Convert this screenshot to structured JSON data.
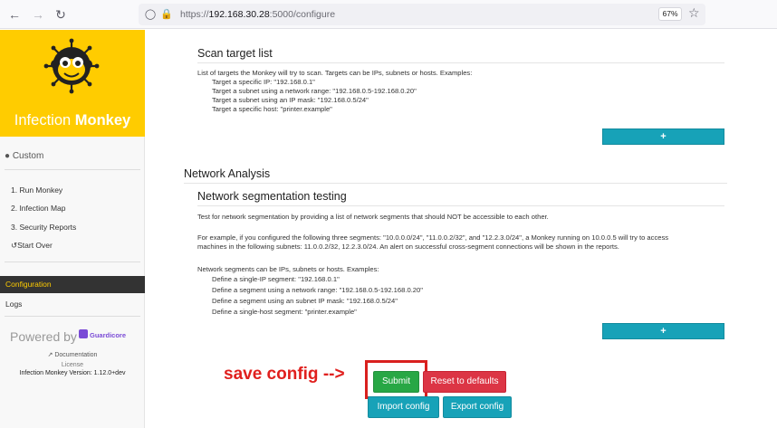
{
  "browser": {
    "url_scheme": "https://",
    "url_host": "192.168.30.28",
    "url_rest": ":5000/configure",
    "zoom": "67%"
  },
  "sidebar": {
    "brand_light": "Infection ",
    "brand_bold": "Monkey",
    "mode": "Custom",
    "steps": [
      "1. Run Monkey",
      "2. Infection Map",
      "3. Security Reports"
    ],
    "start_over": "Start Over",
    "configuration": "Configuration",
    "logs": "Logs",
    "powered_by": "Powered by",
    "guardicore": "Guardicore",
    "documentation": "Documentation",
    "license": "License",
    "version": "Infection Monkey Version: 1.12.0+dev"
  },
  "scan_target": {
    "title": "Scan target list",
    "intro": "List of targets the Monkey will try to scan. Targets can be IPs, subnets or hosts. Examples:",
    "examples": [
      "Target a specific IP: \"192.168.0.1\"",
      "Target a subnet using a network range: \"192.168.0.5-192.168.0.20\"",
      "Target a subnet using an IP mask: \"192.168.0.5/24\"",
      "Target a specific host: \"printer.example\""
    ],
    "add_label": "+"
  },
  "network_analysis": {
    "title": "Network Analysis",
    "segmentation_title": "Network segmentation testing",
    "desc": "Test for network segmentation by providing a list of network segments that should NOT be accessible to each other.",
    "example_line1": "For example, if you configured the following three segments: \"10.0.0.0/24\", \"11.0.0.2/32\", and \"12.2.3.0/24\", a Monkey running on 10.0.0.5 will try to access",
    "example_line2": "machines in the following subnets: 11.0.0.2/32, 12.2.3.0/24. An alert on successful cross-segment connections will be shown in the reports.",
    "segments_intro": "Network segments can be IPs, subnets or hosts. Examples:",
    "segment_examples": [
      "Define a single-IP segment: \"192.168.0.1\"",
      "Define a segment using a network range: \"192.168.0.5-192.168.0.20\"",
      "Define a segment using an subnet IP mask: \"192.168.0.5/24\"",
      "Define a single-host segment: \"printer.example\""
    ],
    "add_label": "+"
  },
  "actions": {
    "annotation": "save config -->",
    "submit": "Submit",
    "reset": "Reset to defaults",
    "import": "Import config",
    "export": "Export config"
  },
  "colors": {
    "brand_yellow": "#ffcc00",
    "info": "#17a2b8",
    "success": "#28a745",
    "danger": "#dc3545",
    "annotation_red": "#e0201e"
  }
}
